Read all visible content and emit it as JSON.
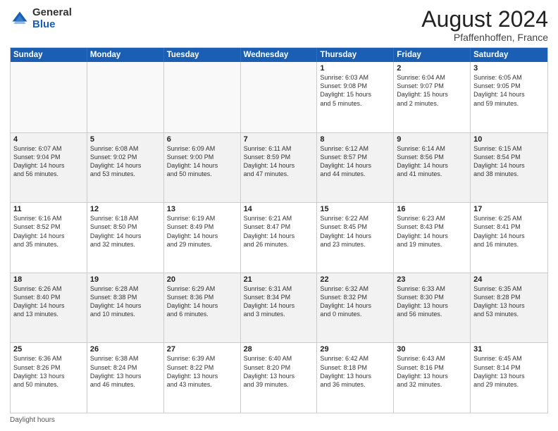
{
  "logo": {
    "general": "General",
    "blue": "Blue"
  },
  "title": {
    "month_year": "August 2024",
    "location": "Pfaffenhoffen, France"
  },
  "header": {
    "days": [
      "Sunday",
      "Monday",
      "Tuesday",
      "Wednesday",
      "Thursday",
      "Friday",
      "Saturday"
    ]
  },
  "footer": {
    "note": "Daylight hours"
  },
  "rows": [
    [
      {
        "day": "",
        "text": "",
        "empty": true
      },
      {
        "day": "",
        "text": "",
        "empty": true
      },
      {
        "day": "",
        "text": "",
        "empty": true
      },
      {
        "day": "",
        "text": "",
        "empty": true
      },
      {
        "day": "1",
        "text": "Sunrise: 6:03 AM\nSunset: 9:08 PM\nDaylight: 15 hours\nand 5 minutes."
      },
      {
        "day": "2",
        "text": "Sunrise: 6:04 AM\nSunset: 9:07 PM\nDaylight: 15 hours\nand 2 minutes."
      },
      {
        "day": "3",
        "text": "Sunrise: 6:05 AM\nSunset: 9:05 PM\nDaylight: 14 hours\nand 59 minutes."
      }
    ],
    [
      {
        "day": "4",
        "text": "Sunrise: 6:07 AM\nSunset: 9:04 PM\nDaylight: 14 hours\nand 56 minutes.",
        "shaded": true
      },
      {
        "day": "5",
        "text": "Sunrise: 6:08 AM\nSunset: 9:02 PM\nDaylight: 14 hours\nand 53 minutes.",
        "shaded": true
      },
      {
        "day": "6",
        "text": "Sunrise: 6:09 AM\nSunset: 9:00 PM\nDaylight: 14 hours\nand 50 minutes.",
        "shaded": true
      },
      {
        "day": "7",
        "text": "Sunrise: 6:11 AM\nSunset: 8:59 PM\nDaylight: 14 hours\nand 47 minutes.",
        "shaded": true
      },
      {
        "day": "8",
        "text": "Sunrise: 6:12 AM\nSunset: 8:57 PM\nDaylight: 14 hours\nand 44 minutes.",
        "shaded": true
      },
      {
        "day": "9",
        "text": "Sunrise: 6:14 AM\nSunset: 8:56 PM\nDaylight: 14 hours\nand 41 minutes.",
        "shaded": true
      },
      {
        "day": "10",
        "text": "Sunrise: 6:15 AM\nSunset: 8:54 PM\nDaylight: 14 hours\nand 38 minutes.",
        "shaded": true
      }
    ],
    [
      {
        "day": "11",
        "text": "Sunrise: 6:16 AM\nSunset: 8:52 PM\nDaylight: 14 hours\nand 35 minutes."
      },
      {
        "day": "12",
        "text": "Sunrise: 6:18 AM\nSunset: 8:50 PM\nDaylight: 14 hours\nand 32 minutes."
      },
      {
        "day": "13",
        "text": "Sunrise: 6:19 AM\nSunset: 8:49 PM\nDaylight: 14 hours\nand 29 minutes."
      },
      {
        "day": "14",
        "text": "Sunrise: 6:21 AM\nSunset: 8:47 PM\nDaylight: 14 hours\nand 26 minutes."
      },
      {
        "day": "15",
        "text": "Sunrise: 6:22 AM\nSunset: 8:45 PM\nDaylight: 14 hours\nand 23 minutes."
      },
      {
        "day": "16",
        "text": "Sunrise: 6:23 AM\nSunset: 8:43 PM\nDaylight: 14 hours\nand 19 minutes."
      },
      {
        "day": "17",
        "text": "Sunrise: 6:25 AM\nSunset: 8:41 PM\nDaylight: 14 hours\nand 16 minutes."
      }
    ],
    [
      {
        "day": "18",
        "text": "Sunrise: 6:26 AM\nSunset: 8:40 PM\nDaylight: 14 hours\nand 13 minutes.",
        "shaded": true
      },
      {
        "day": "19",
        "text": "Sunrise: 6:28 AM\nSunset: 8:38 PM\nDaylight: 14 hours\nand 10 minutes.",
        "shaded": true
      },
      {
        "day": "20",
        "text": "Sunrise: 6:29 AM\nSunset: 8:36 PM\nDaylight: 14 hours\nand 6 minutes.",
        "shaded": true
      },
      {
        "day": "21",
        "text": "Sunrise: 6:31 AM\nSunset: 8:34 PM\nDaylight: 14 hours\nand 3 minutes.",
        "shaded": true
      },
      {
        "day": "22",
        "text": "Sunrise: 6:32 AM\nSunset: 8:32 PM\nDaylight: 14 hours\nand 0 minutes.",
        "shaded": true
      },
      {
        "day": "23",
        "text": "Sunrise: 6:33 AM\nSunset: 8:30 PM\nDaylight: 13 hours\nand 56 minutes.",
        "shaded": true
      },
      {
        "day": "24",
        "text": "Sunrise: 6:35 AM\nSunset: 8:28 PM\nDaylight: 13 hours\nand 53 minutes.",
        "shaded": true
      }
    ],
    [
      {
        "day": "25",
        "text": "Sunrise: 6:36 AM\nSunset: 8:26 PM\nDaylight: 13 hours\nand 50 minutes."
      },
      {
        "day": "26",
        "text": "Sunrise: 6:38 AM\nSunset: 8:24 PM\nDaylight: 13 hours\nand 46 minutes."
      },
      {
        "day": "27",
        "text": "Sunrise: 6:39 AM\nSunset: 8:22 PM\nDaylight: 13 hours\nand 43 minutes."
      },
      {
        "day": "28",
        "text": "Sunrise: 6:40 AM\nSunset: 8:20 PM\nDaylight: 13 hours\nand 39 minutes."
      },
      {
        "day": "29",
        "text": "Sunrise: 6:42 AM\nSunset: 8:18 PM\nDaylight: 13 hours\nand 36 minutes."
      },
      {
        "day": "30",
        "text": "Sunrise: 6:43 AM\nSunset: 8:16 PM\nDaylight: 13 hours\nand 32 minutes."
      },
      {
        "day": "31",
        "text": "Sunrise: 6:45 AM\nSunset: 8:14 PM\nDaylight: 13 hours\nand 29 minutes."
      }
    ]
  ]
}
